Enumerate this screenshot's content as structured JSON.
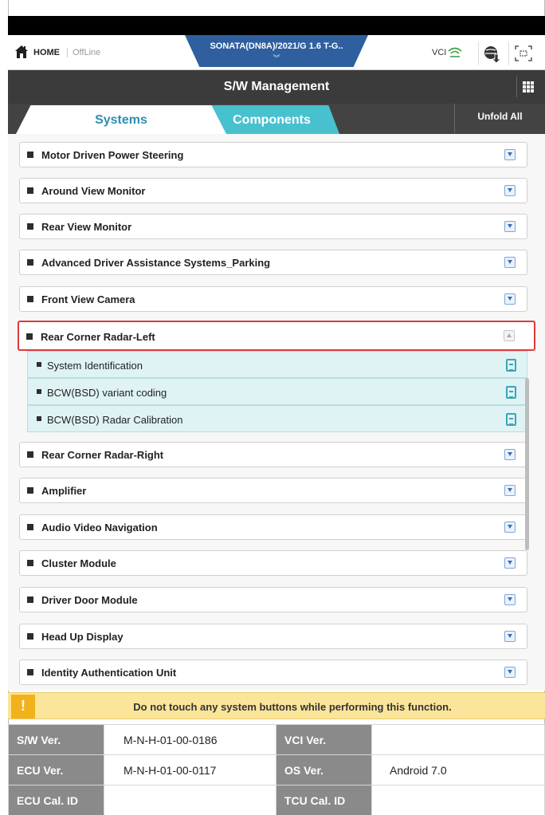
{
  "header": {
    "home_label": "HOME",
    "offline_label": "OffLine",
    "vehicle": "SONATA(DN8A)/2021/G 1.6 T-G..",
    "vci_label": "VCI"
  },
  "title": "S/W Management",
  "tabs": {
    "systems": "Systems",
    "components": "Components",
    "unfold_all": "Unfold All"
  },
  "systems": [
    {
      "label": "Motor Driven Power Steering"
    },
    {
      "label": "Around View Monitor"
    },
    {
      "label": "Rear View Monitor"
    },
    {
      "label": "Advanced Driver Assistance Systems_Parking"
    },
    {
      "label": "Front View Camera"
    },
    {
      "label": "Rear Corner Radar-Left",
      "expanded": true
    },
    {
      "label": "Rear Corner Radar-Right"
    },
    {
      "label": "Amplifier"
    },
    {
      "label": "Audio Video Navigation"
    },
    {
      "label": "Cluster Module"
    },
    {
      "label": "Driver Door Module"
    },
    {
      "label": "Head Up Display"
    },
    {
      "label": "Identity Authentication Unit"
    }
  ],
  "sub_items": [
    {
      "label": "System Identification"
    },
    {
      "label": "BCW(BSD) variant coding"
    },
    {
      "label": "BCW(BSD) Radar Calibration"
    }
  ],
  "warning": {
    "icon": "!",
    "text": "Do not touch any system buttons while performing this function."
  },
  "info": {
    "sw_ver_label": "S/W Ver.",
    "sw_ver_value": "M-N-H-01-00-0186",
    "vci_ver_label": "VCI Ver.",
    "vci_ver_value": "",
    "ecu_ver_label": "ECU Ver.",
    "ecu_ver_value": "M-N-H-01-00-0117",
    "os_ver_label": "OS Ver.",
    "os_ver_value": "Android 7.0",
    "ecu_cal_label": "ECU Cal. ID",
    "ecu_cal_value": "",
    "tcu_cal_label": "TCU Cal. ID",
    "tcu_cal_value": ""
  },
  "colors": {
    "header_tab": "#2f5f9f",
    "title_bar": "#3b3b3b",
    "systems_tab_text": "#2b8fb1",
    "components_tab": "#48c1cf",
    "highlight_border": "#e0393b",
    "sub_item_bg": "#dff3f5",
    "warning_bg": "#fbe59a",
    "info_label_bg": "#8a8a8a"
  }
}
